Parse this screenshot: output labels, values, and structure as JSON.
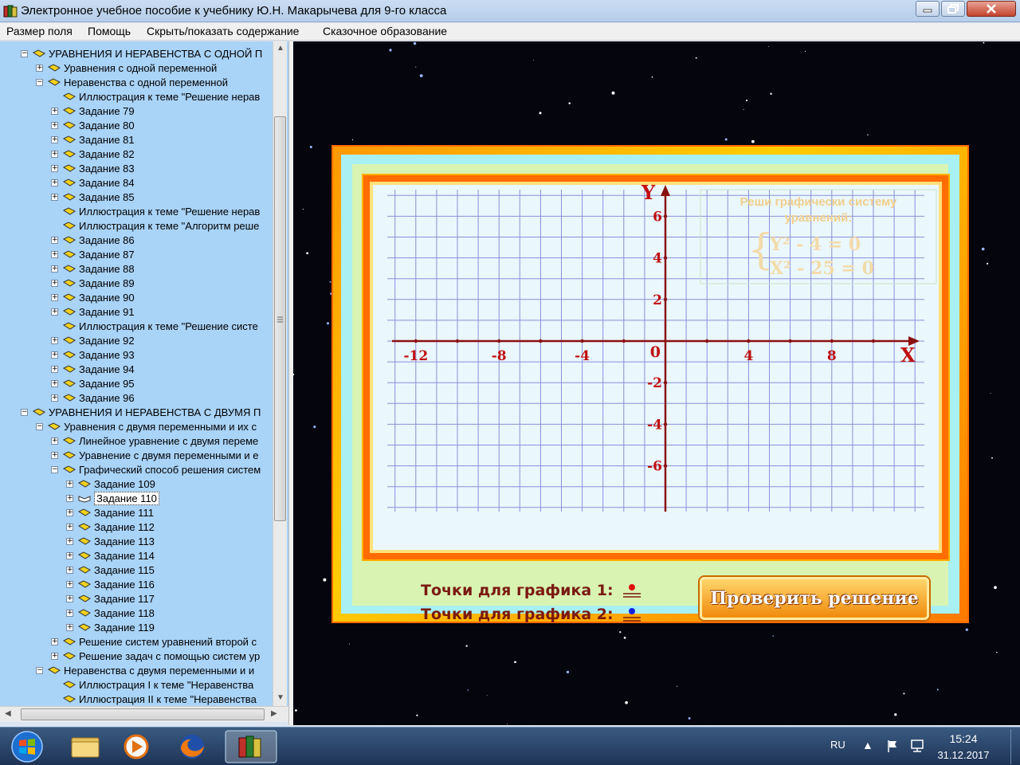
{
  "window": {
    "title": "Электронное учебное пособие к учебнику Ю.Н. Макарычева для 9-го класса"
  },
  "menu": [
    {
      "label": "Размер поля"
    },
    {
      "label": "Помощь"
    },
    {
      "label": "Скрыть/показать содержание"
    },
    {
      "label": "Сказочное образование"
    }
  ],
  "tree": {
    "items": [
      {
        "level": 1,
        "exp": "minus",
        "label": "УРАВНЕНИЯ И НЕРАВЕНСТВА С ОДНОЙ П"
      },
      {
        "level": 2,
        "exp": "plus",
        "label": "Уравнения с одной переменной"
      },
      {
        "level": 2,
        "exp": "minus",
        "label": "Неравенства с одной переменной"
      },
      {
        "level": 3,
        "exp": "none",
        "label": "Иллюстрация к теме \"Решение нерав"
      },
      {
        "level": 3,
        "exp": "plus",
        "label": "Задание 79"
      },
      {
        "level": 3,
        "exp": "plus",
        "label": "Задание 80"
      },
      {
        "level": 3,
        "exp": "plus",
        "label": "Задание 81"
      },
      {
        "level": 3,
        "exp": "plus",
        "label": "Задание 82"
      },
      {
        "level": 3,
        "exp": "plus",
        "label": "Задание 83"
      },
      {
        "level": 3,
        "exp": "plus",
        "label": "Задание 84"
      },
      {
        "level": 3,
        "exp": "plus",
        "label": "Задание 85"
      },
      {
        "level": 3,
        "exp": "none",
        "label": "Иллюстрация к теме \"Решение нерав"
      },
      {
        "level": 3,
        "exp": "none",
        "label": "Иллюстрация к теме \"Алгоритм реше"
      },
      {
        "level": 3,
        "exp": "plus",
        "label": "Задание 86"
      },
      {
        "level": 3,
        "exp": "plus",
        "label": "Задание 87"
      },
      {
        "level": 3,
        "exp": "plus",
        "label": "Задание 88"
      },
      {
        "level": 3,
        "exp": "plus",
        "label": "Задание 89"
      },
      {
        "level": 3,
        "exp": "plus",
        "label": "Задание 90"
      },
      {
        "level": 3,
        "exp": "plus",
        "label": "Задание 91"
      },
      {
        "level": 3,
        "exp": "none",
        "label": "Иллюстрация к теме \"Решение систе"
      },
      {
        "level": 3,
        "exp": "plus",
        "label": "Задание 92"
      },
      {
        "level": 3,
        "exp": "plus",
        "label": "Задание 93"
      },
      {
        "level": 3,
        "exp": "plus",
        "label": "Задание 94"
      },
      {
        "level": 3,
        "exp": "plus",
        "label": "Задание 95"
      },
      {
        "level": 3,
        "exp": "plus",
        "label": "Задание 96"
      },
      {
        "level": 1,
        "exp": "minus",
        "label": "УРАВНЕНИЯ И НЕРАВЕНСТВА С ДВУМЯ П"
      },
      {
        "level": 2,
        "exp": "minus",
        "label": "Уравнения с двумя переменными и их с"
      },
      {
        "level": 3,
        "exp": "plus",
        "label": "Линейное уравнение с двумя переме"
      },
      {
        "level": 3,
        "exp": "plus",
        "label": "Уравнение с двумя переменными и е"
      },
      {
        "level": 3,
        "exp": "minus",
        "label": "Графический способ решения систем"
      },
      {
        "level": 4,
        "exp": "plus",
        "label": "Задание 109"
      },
      {
        "level": 4,
        "exp": "plus",
        "label": "Задание 110",
        "selected": true
      },
      {
        "level": 4,
        "exp": "plus",
        "label": "Задание 111"
      },
      {
        "level": 4,
        "exp": "plus",
        "label": "Задание 112"
      },
      {
        "level": 4,
        "exp": "plus",
        "label": "Задание 113"
      },
      {
        "level": 4,
        "exp": "plus",
        "label": "Задание 114"
      },
      {
        "level": 4,
        "exp": "plus",
        "label": "Задание 115"
      },
      {
        "level": 4,
        "exp": "plus",
        "label": "Задание 116"
      },
      {
        "level": 4,
        "exp": "plus",
        "label": "Задание 117"
      },
      {
        "level": 4,
        "exp": "plus",
        "label": "Задание 118"
      },
      {
        "level": 4,
        "exp": "plus",
        "label": "Задание 119"
      },
      {
        "level": 3,
        "exp": "plus",
        "label": "Решение систем уравнений второй с"
      },
      {
        "level": 3,
        "exp": "plus",
        "label": "Решение задач с помощью систем ур"
      },
      {
        "level": 2,
        "exp": "minus",
        "label": "Неравенства с двумя переменными и и"
      },
      {
        "level": 3,
        "exp": "none",
        "label": "Иллюстрация I к теме \"Неравенства"
      },
      {
        "level": 3,
        "exp": "none",
        "label": "Иллюстрация II к теме \"Неравенства"
      }
    ]
  },
  "graph": {
    "axis_x_label": "X",
    "axis_y_label": "Y",
    "origin_label": "0",
    "x_ticks": [
      "-12",
      "-8",
      "-4",
      "4",
      "8"
    ],
    "y_ticks": [
      "6",
      "4",
      "2",
      "-2",
      "-4",
      "-6"
    ],
    "task": {
      "line1": "Реши графически систему",
      "line2": "уравнений:",
      "eq1": "Y² - 4 = 0",
      "eq2": "X² - 25 = 0"
    }
  },
  "controls": {
    "points1_label": "Точки для графика 1:",
    "points2_label": "Точки для графика 2:",
    "points1_color": "#e01010",
    "points2_color": "#1020e0",
    "check_button": "Проверить решение"
  },
  "taskbar": {
    "lang": "RU",
    "time": "15:24",
    "date": "31.12.2017"
  }
}
